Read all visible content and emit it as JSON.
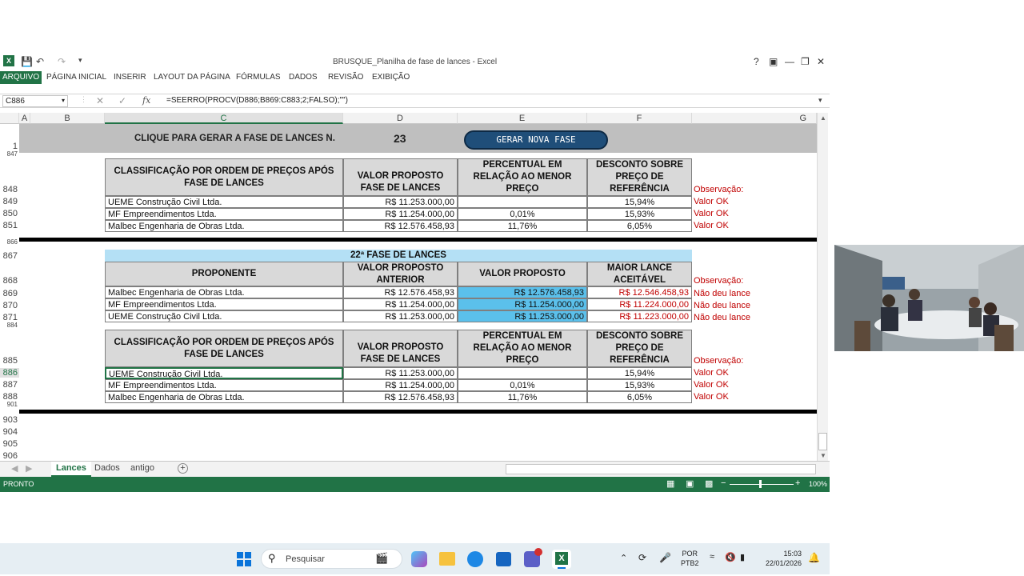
{
  "app": {
    "title": "BRUSQUE_Planilha de fase de lances - Excel",
    "help": "?",
    "tabs": [
      "ARQUIVO",
      "PÁGINA INICIAL",
      "INSERIR",
      "LAYOUT DA PÁGINA",
      "FÓRMULAS",
      "DADOS",
      "REVISÃO",
      "EXIBIÇÃO"
    ]
  },
  "formula_bar": {
    "name_box": "C886",
    "fx": "fx",
    "formula": "=SEERRO(PROCV(D886;B869:C883;2;FALSO);\"\")"
  },
  "columns": [
    "A",
    "B",
    "C",
    "D",
    "E",
    "F",
    "G"
  ],
  "banner": {
    "text": "CLIQUE PARA GERAR A FASE DE LANCES N.",
    "number": "23",
    "button": "GERAR NOVA FASE"
  },
  "row_numbers": {
    "r1": "1",
    "r847": "847",
    "r848": "848",
    "r849": "849",
    "r850": "850",
    "r851": "851",
    "r866": "866",
    "r867": "867",
    "r868": "868",
    "r869": "869",
    "r870": "870",
    "r871": "871",
    "r884": "884",
    "r885": "885",
    "r886": "886",
    "r887": "887",
    "r888": "888",
    "r901": "901",
    "r903": "903",
    "r904": "904",
    "r905": "905",
    "r906": "906"
  },
  "classif_headers": {
    "c": "CLASSIFICAÇÃO POR ORDEM DE PREÇOS APÓS FASE DE LANCES",
    "d": "VALOR PROPOSTO FASE DE LANCES",
    "e": "PERCENTUAL EM RELAÇÃO AO MENOR PREÇO",
    "f": "DESCONTO SOBRE PREÇO DE REFERÊNCIA",
    "obs": "Observação:"
  },
  "table1": [
    {
      "name": "UEME Construção Civil Ltda.",
      "valor": "R$ 11.253.000,00",
      "perc": "",
      "desc": "15,94%",
      "obs": "Valor OK"
    },
    {
      "name": "MF Empreendimentos Ltda.",
      "valor": "R$ 11.254.000,00",
      "perc": "0,01%",
      "desc": "15,93%",
      "obs": "Valor OK"
    },
    {
      "name": "Malbec Engenharia de Obras Ltda.",
      "valor": "R$ 12.576.458,93",
      "perc": "11,76%",
      "desc": "6,05%",
      "obs": "Valor OK"
    }
  ],
  "fase22": {
    "title": "22ª FASE DE LANCES",
    "h_prop": "PROPONENTE",
    "h_ant": "VALOR PROPOSTO ANTERIOR",
    "h_val": "VALOR PROPOSTO",
    "h_maior": "MAIOR LANCE ACEITÁVEL",
    "obs": "Observação:",
    "rows": [
      {
        "name": "Malbec Engenharia de Obras Ltda.",
        "ant": "R$ 12.576.458,93",
        "val": "R$ 12.576.458,93",
        "maior": "R$ 12.546.458,93",
        "obs": "Não deu lance"
      },
      {
        "name": "MF Empreendimentos Ltda.",
        "ant": "R$ 11.254.000,00",
        "val": "R$ 11.254.000,00",
        "maior": "R$ 11.224.000,00",
        "obs": "Não deu lance"
      },
      {
        "name": "UEME Construção Civil Ltda.",
        "ant": "R$ 11.253.000,00",
        "val": "R$ 11.253.000,00",
        "maior": "R$ 11.223.000,00",
        "obs": "Não deu lance"
      }
    ]
  },
  "table2": [
    {
      "name": "UEME Construção Civil Ltda.",
      "valor": "R$ 11.253.000,00",
      "perc": "",
      "desc": "15,94%",
      "obs": "Valor OK"
    },
    {
      "name": "MF Empreendimentos Ltda.",
      "valor": "R$ 11.254.000,00",
      "perc": "0,01%",
      "desc": "15,93%",
      "obs": "Valor OK"
    },
    {
      "name": "Malbec Engenharia de Obras Ltda.",
      "valor": "R$ 12.576.458,93",
      "perc": "11,76%",
      "desc": "6,05%",
      "obs": "Valor OK"
    }
  ],
  "sheets": [
    "Lances",
    "Dados",
    "antigo"
  ],
  "status": {
    "ready": "PRONTO",
    "zoom": "100%"
  },
  "taskbar": {
    "search": "Pesquisar",
    "lang1": "POR",
    "lang2": "PTB2",
    "time": "15:03",
    "date": "22/01/2026"
  },
  "colors": {
    "excel_green": "#217346",
    "highlight_blue": "#5bc0eb",
    "warning_red": "#c00000"
  }
}
